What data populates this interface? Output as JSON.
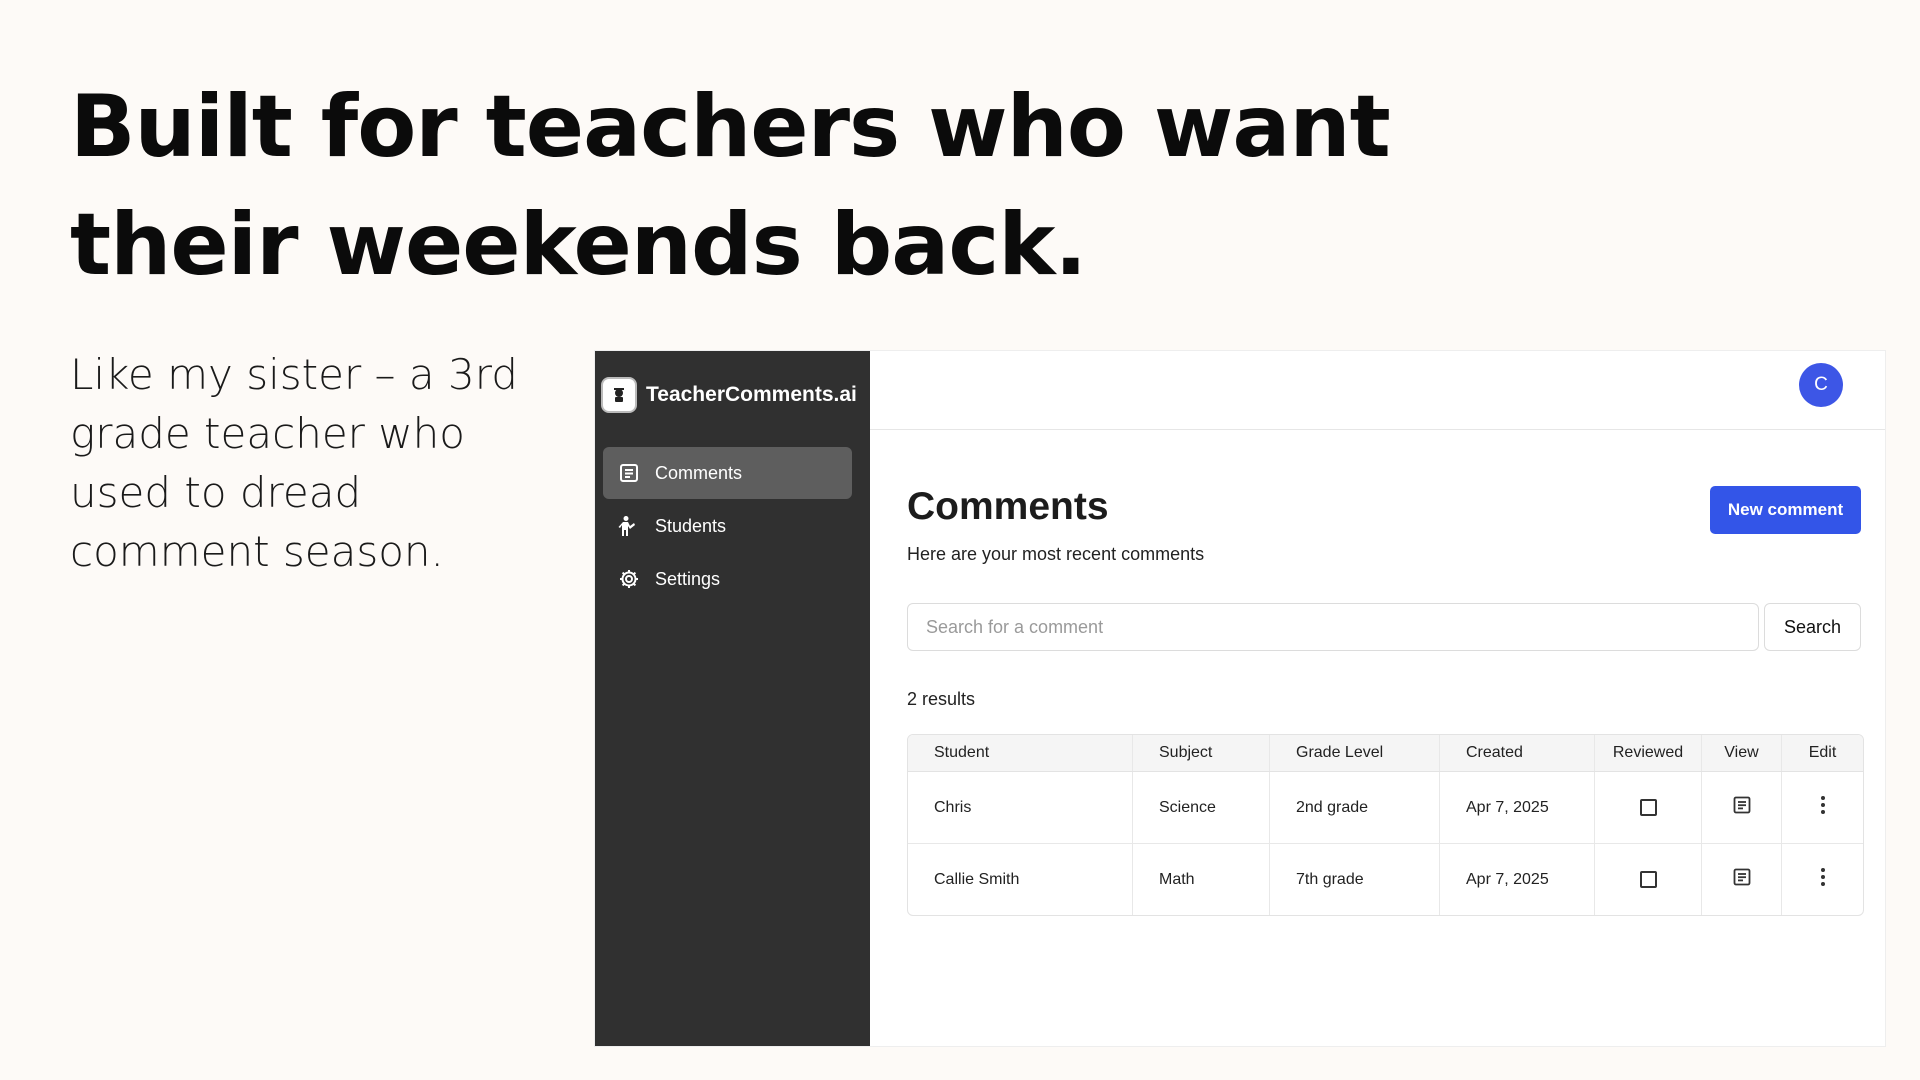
{
  "headline": {
    "line1": "Built for teachers who want",
    "line2": "their weekends back."
  },
  "subtext": "Like my sister – a 3rd grade teacher who used to dread comment season.",
  "app": {
    "brand": {
      "name": "TeacherComments.ai",
      "logo_icon": "graduate-icon"
    },
    "sidebar": {
      "items": [
        {
          "label": "Comments",
          "icon": "document-icon",
          "active": true
        },
        {
          "label": "Students",
          "icon": "person-icon",
          "active": false
        },
        {
          "label": "Settings",
          "icon": "gear-icon",
          "active": false
        }
      ]
    },
    "avatar": {
      "initial": "C",
      "color": "#3d56e6"
    },
    "page": {
      "title": "Comments",
      "subtitle": "Here are your most recent comments",
      "new_button": "New comment",
      "search_placeholder": "Search for a comment",
      "search_button": "Search",
      "results_count": "2 results"
    },
    "table": {
      "headers": [
        "Student",
        "Subject",
        "Grade Level",
        "Created",
        "Reviewed",
        "View",
        "Edit"
      ],
      "rows": [
        {
          "student": "Chris",
          "subject": "Science",
          "grade": "2nd grade",
          "created": "Apr 7, 2025",
          "reviewed": false
        },
        {
          "student": "Callie Smith",
          "subject": "Math",
          "grade": "7th grade",
          "created": "Apr 7, 2025",
          "reviewed": false
        }
      ]
    },
    "colors": {
      "primary": "#3355e8",
      "sidebar": "#303030",
      "active_item": "#5e5e5e"
    }
  }
}
